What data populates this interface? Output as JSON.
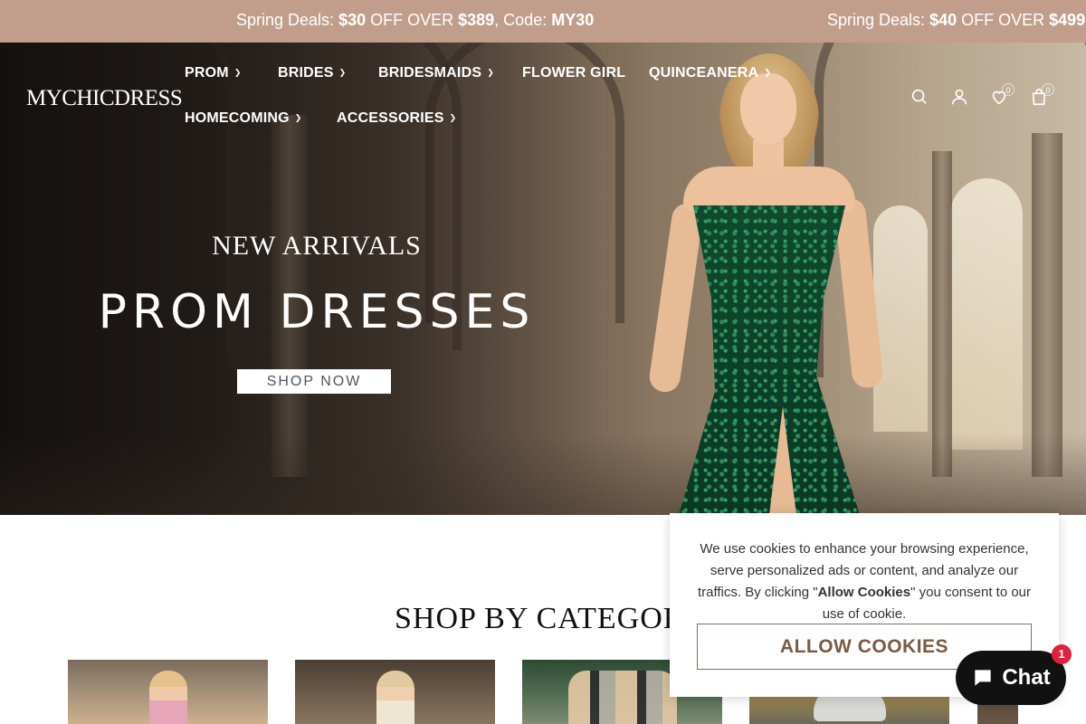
{
  "announcement": {
    "msg1": {
      "pre": "Spring Deals: ",
      "amount": "$30",
      "mid": " OFF OVER ",
      "threshold": "$389",
      "code_label": ", Code: ",
      "code": "MY30"
    },
    "msg2": {
      "pre": "Spring Deals: ",
      "amount": "$40",
      "mid": " OFF OVER ",
      "threshold": "$499",
      "tail": ","
    }
  },
  "header": {
    "logo": "MYCHICDRESS",
    "nav": [
      {
        "label": "PROM",
        "has_dropdown": true
      },
      {
        "label": "BRIDES",
        "has_dropdown": true
      },
      {
        "label": "BRIDESMAIDS",
        "has_dropdown": true
      },
      {
        "label": "FLOWER GIRL",
        "has_dropdown": false
      },
      {
        "label": "QUINCEANERA",
        "has_dropdown": true
      },
      {
        "label": "HOMECOMING",
        "has_dropdown": true
      },
      {
        "label": "ACCESSORIES",
        "has_dropdown": true
      }
    ],
    "icons": {
      "search": "search-icon",
      "account": "user-icon",
      "wishlist": "heart-icon",
      "cart": "bag-icon"
    },
    "wishlist_count": "0",
    "cart_count": "0"
  },
  "hero": {
    "subtitle": "NEW ARRIVALS",
    "title": "PROM DRESSES",
    "cta": "SHOP NOW"
  },
  "categories": {
    "title": "SHOP BY CATEGORY"
  },
  "cookie": {
    "text_pre": "We use cookies to enhance your browsing experience, serve personalized ads or content, and analyze our traffics. By clicking \"",
    "text_bold": "Allow Cookies",
    "text_post": "\" you consent to our use of cookie.",
    "button": "ALLOW COOKIES"
  },
  "chat": {
    "label": "Chat",
    "badge": "1"
  },
  "colors": {
    "announcement_bg": "#c19e8b",
    "accent_brown": "#8b6b55",
    "chat_bg": "#111111",
    "badge_red": "#e0213b"
  }
}
